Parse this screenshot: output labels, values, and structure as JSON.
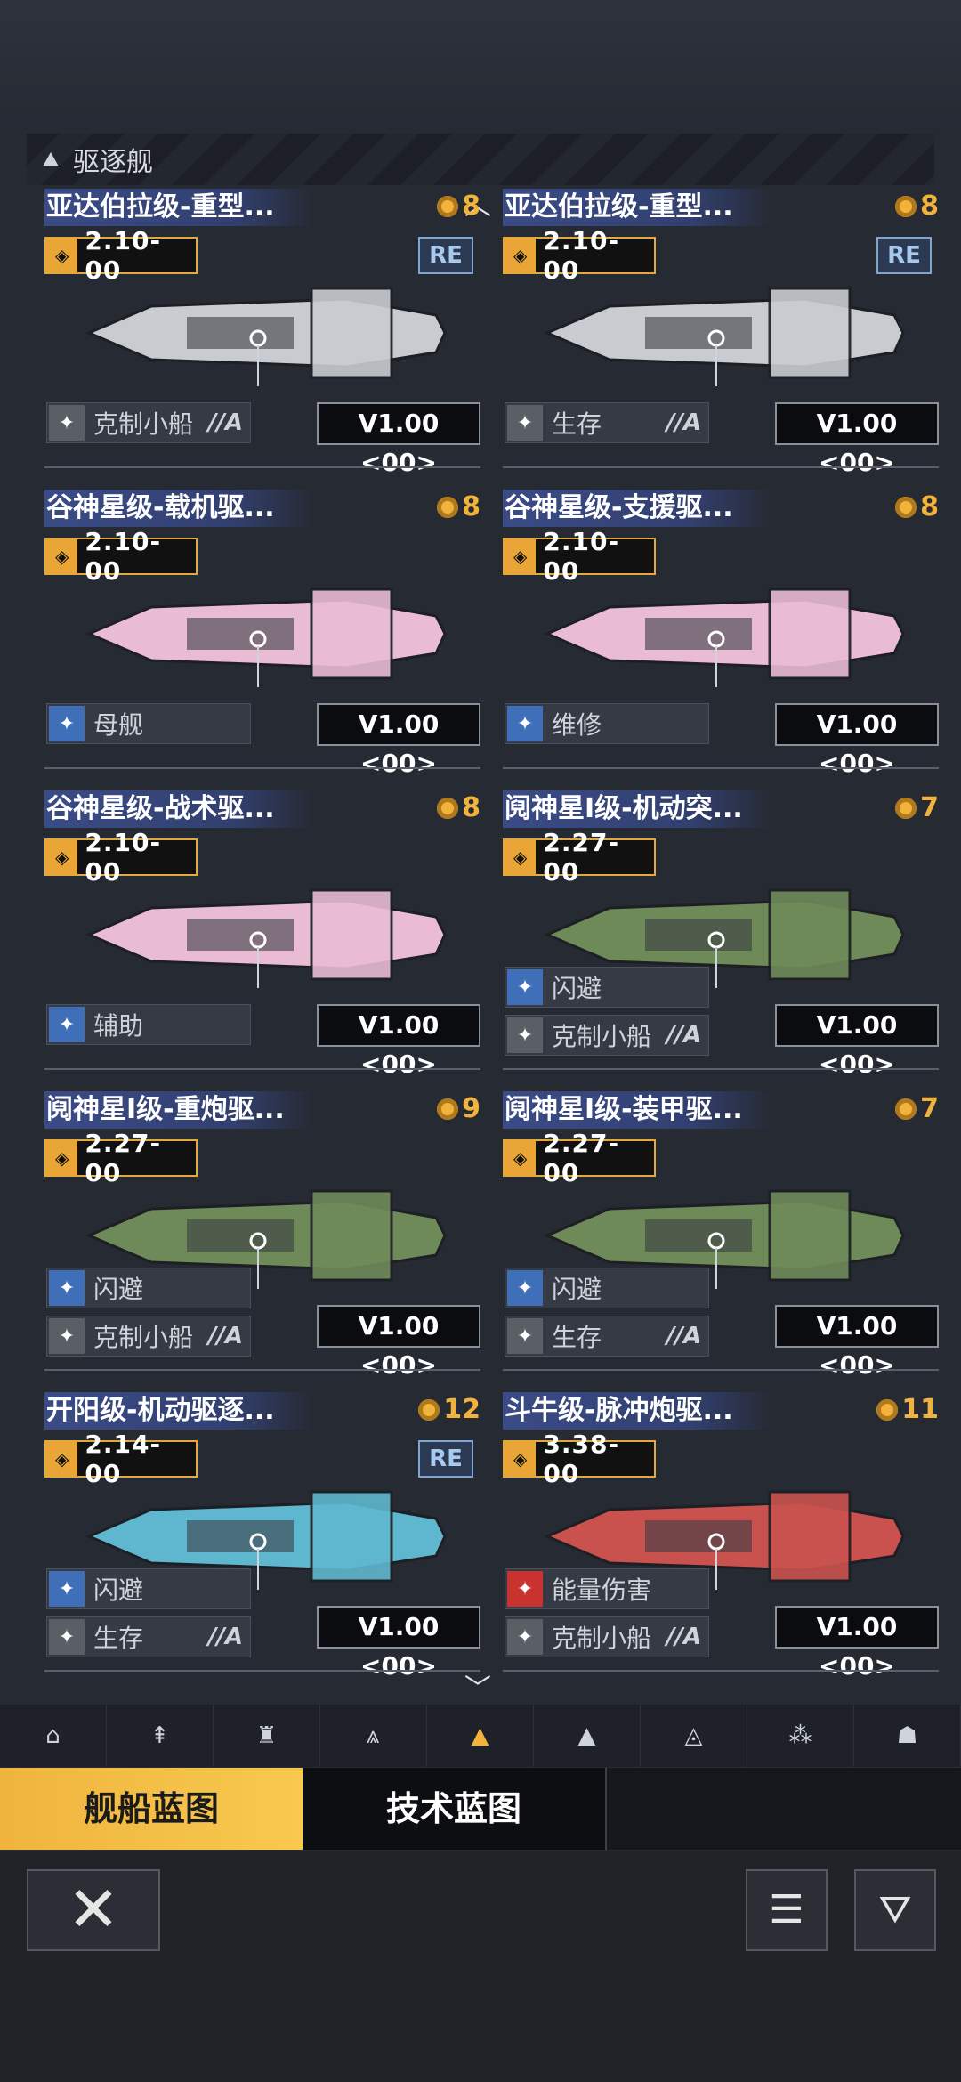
{
  "section": {
    "label": "驱逐舰"
  },
  "ships": [
    {
      "name": "亚达伯拉级-重型...",
      "rank": "8",
      "version": "2.10-00",
      "re": "RE",
      "tags": [
        {
          "label": "克制小船",
          "grade": "//A"
        }
      ],
      "release": "V1.00 <00>",
      "hull_color": "#c8ccd0",
      "icon_color": "#5a5f66"
    },
    {
      "name": "亚达伯拉级-重型...",
      "rank": "8",
      "version": "2.10-00",
      "re": "RE",
      "tags": [
        {
          "label": "生存",
          "grade": "//A"
        }
      ],
      "release": "V1.00 <00>",
      "hull_color": "#c8ccd0",
      "icon_color": "#5a5f66"
    },
    {
      "name": "谷神星级-载机驱...",
      "rank": "8",
      "version": "2.10-00",
      "re": "",
      "tags": [
        {
          "label": "母舰",
          "grade": ""
        }
      ],
      "release": "V1.00 <00>",
      "hull_color": "#e9bcd3",
      "icon_color": "#3f6fb8"
    },
    {
      "name": "谷神星级-支援驱...",
      "rank": "8",
      "version": "2.10-00",
      "re": "",
      "tags": [
        {
          "label": "维修",
          "grade": ""
        }
      ],
      "release": "V1.00 <00>",
      "hull_color": "#e9bcd3",
      "icon_color": "#3f6fb8"
    },
    {
      "name": "谷神星级-战术驱...",
      "rank": "8",
      "version": "2.10-00",
      "re": "",
      "tags": [
        {
          "label": "辅助",
          "grade": ""
        }
      ],
      "release": "V1.00 <00>",
      "hull_color": "#e9bcd3",
      "icon_color": "#3f6fb8"
    },
    {
      "name": "阋神星I级-机动突...",
      "rank": "7",
      "version": "2.27-00",
      "re": "",
      "tags": [
        {
          "label": "闪避",
          "grade": ""
        },
        {
          "label": "克制小船",
          "grade": "//A"
        }
      ],
      "release": "V1.00 <00>",
      "hull_color": "#6f8a59",
      "icon_color": "#3f6fb8"
    },
    {
      "name": "阋神星I级-重炮驱...",
      "rank": "9",
      "version": "2.27-00",
      "re": "",
      "tags": [
        {
          "label": "闪避",
          "grade": ""
        },
        {
          "label": "克制小船",
          "grade": "//A"
        }
      ],
      "release": "V1.00 <00>",
      "hull_color": "#6f8a59",
      "icon_color": "#3f6fb8"
    },
    {
      "name": "阋神星I级-装甲驱...",
      "rank": "7",
      "version": "2.27-00",
      "re": "",
      "tags": [
        {
          "label": "闪避",
          "grade": ""
        },
        {
          "label": "生存",
          "grade": "//A"
        }
      ],
      "release": "V1.00 <00>",
      "hull_color": "#6f8a59",
      "icon_color": "#3f6fb8"
    },
    {
      "name": "开阳级-机动驱逐...",
      "rank": "12",
      "version": "2.14-00",
      "re": "RE",
      "tags": [
        {
          "label": "闪避",
          "grade": ""
        },
        {
          "label": "生存",
          "grade": "//A"
        }
      ],
      "release": "V1.00 <00>",
      "hull_color": "#5fb7cf",
      "icon_color": "#3f6fb8"
    },
    {
      "name": "斗牛级-脉冲炮驱...",
      "rank": "11",
      "version": "3.38-00",
      "re": "",
      "tags": [
        {
          "label": "能量伤害",
          "grade": ""
        },
        {
          "label": "克制小船",
          "grade": "//A"
        }
      ],
      "release": "V1.00 <00>",
      "hull_color": "#c9524e",
      "icon_color": "#c9332f"
    }
  ],
  "type_bar": {
    "items": [
      "⌂",
      "⇞",
      "♜",
      "⩓",
      "▲",
      "▲",
      "◬",
      "⁂",
      "☗"
    ],
    "active_index": 4
  },
  "tabs": {
    "active": "舰船蓝图",
    "inactive": "技术蓝图"
  },
  "bottom": {
    "close": "✕",
    "clipboard": "☰",
    "filter": "⛛"
  }
}
